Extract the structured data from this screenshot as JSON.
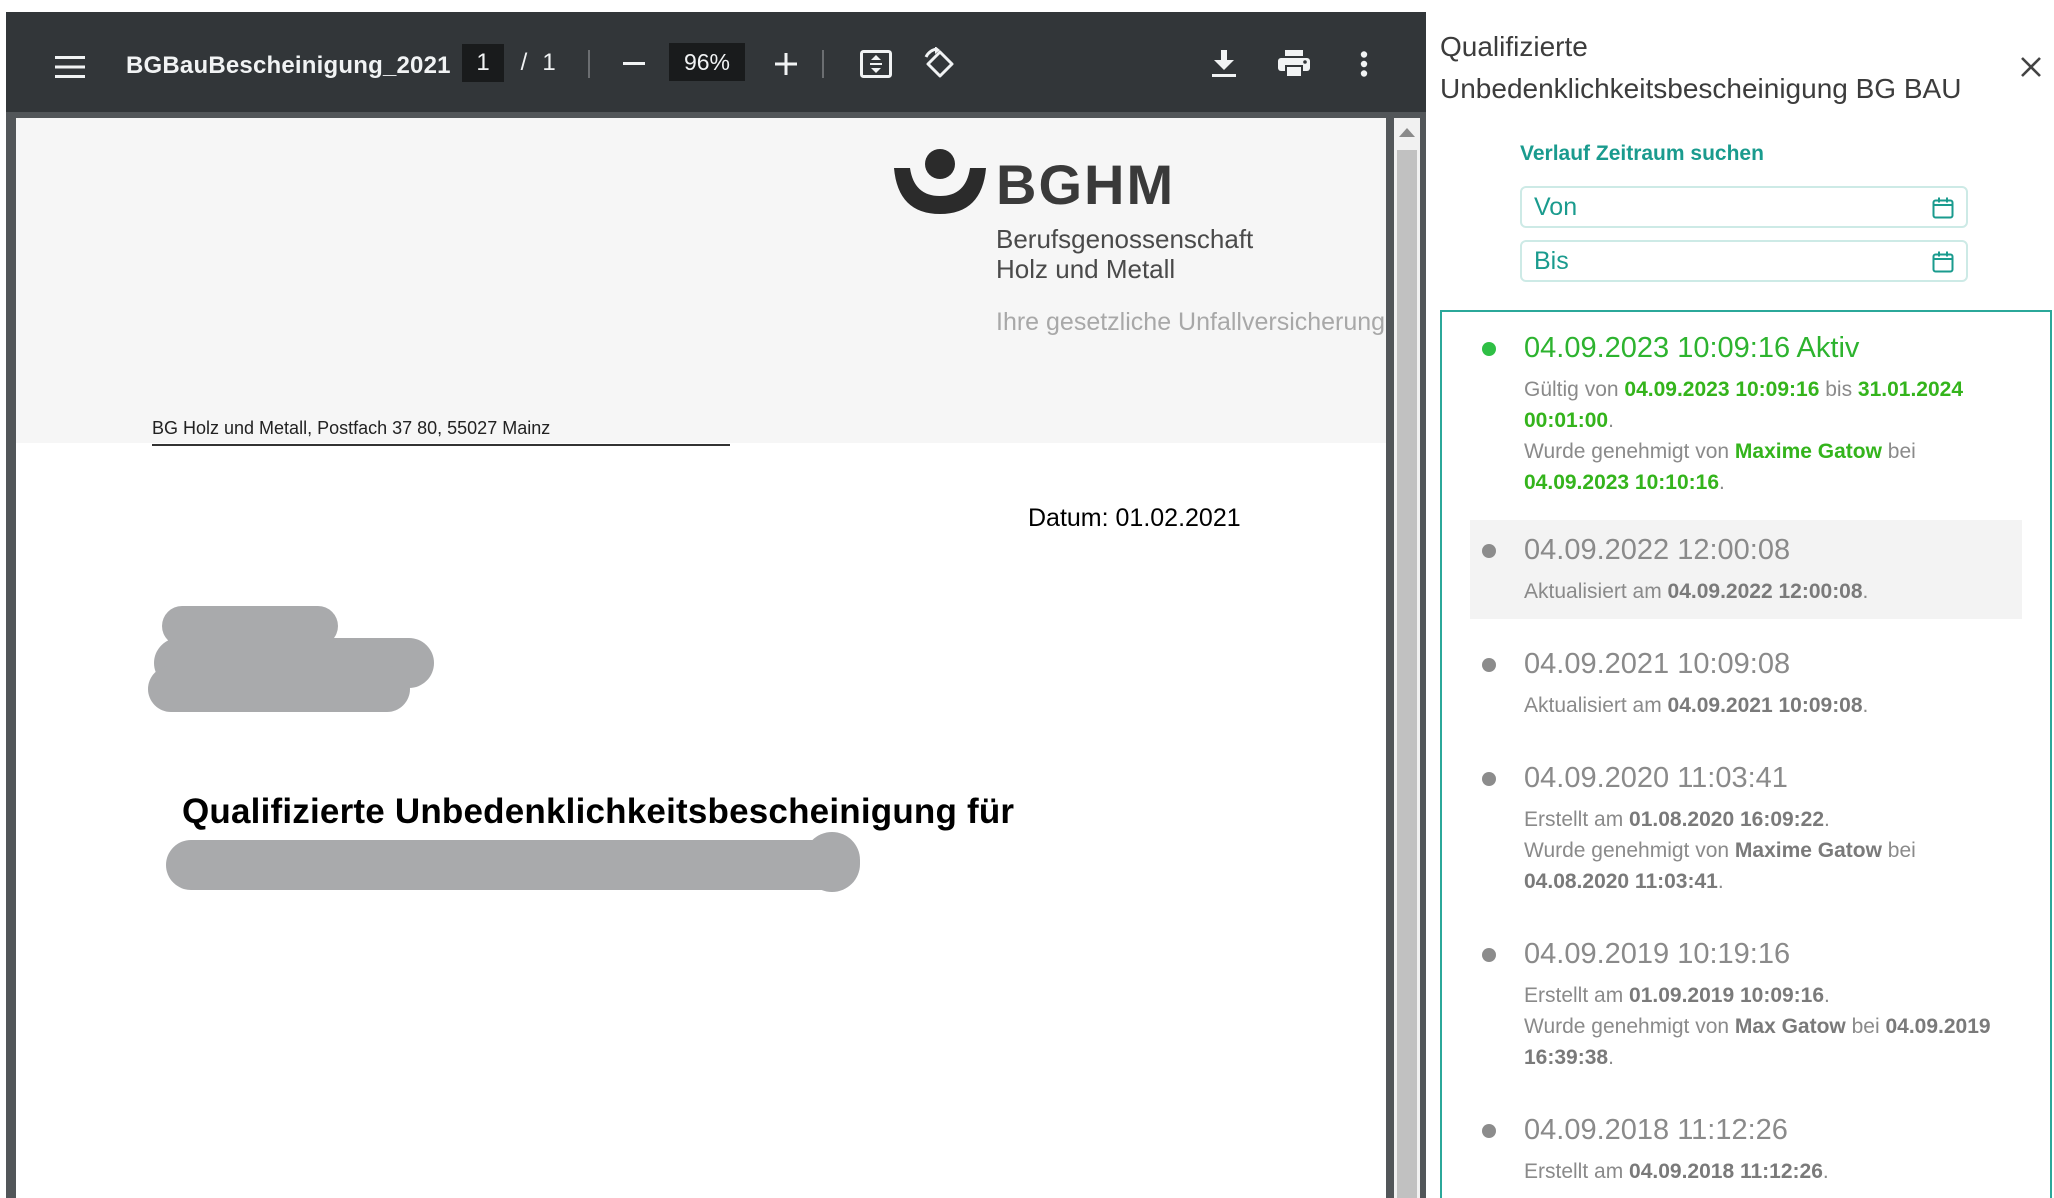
{
  "viewer": {
    "title": "BGBauBescheinigung_2021",
    "page_current": "1",
    "page_separator": "/",
    "page_total": "1",
    "zoom": "96%"
  },
  "document": {
    "logo_text": "BGHM",
    "logo_line1": "Berufsgenossenschaft",
    "logo_line2": "Holz und Metall",
    "logo_tagline": "Ihre gesetzliche Unfallversicherung",
    "sender": "BG Holz und Metall, Postfach 37 80, 55027 Mainz",
    "datum": "Datum: 01.02.2021",
    "heading": "Qualifizierte Unbedenklichkeitsbescheinigung für"
  },
  "panel": {
    "title": "Qualifizierte Unbedenklichkeitsbescheinigung BG BAU",
    "search_label": "Verlauf Zeitraum suchen",
    "von": "Von",
    "bis": "Bis",
    "colors": {
      "accent": "#1a9b8e",
      "active": "#2db32f",
      "muted": "#8a8a8a"
    }
  },
  "history": [
    {
      "date": "04.09.2023 10:09:16 Aktiv",
      "active": true,
      "l1_a": "Gültig von ",
      "l1_b": "04.09.2023 10:09:16",
      "l1_c": " bis ",
      "l1_d": "31.01.2024",
      "l2_a": "00:01:00",
      "l2_b": ".",
      "l3_a": "Wurde genehmigt von ",
      "l3_b": "Maxime Gatow",
      "l3_c": " bei",
      "l4_a": "04.09.2023 10:10:16",
      "l4_b": "."
    },
    {
      "date": "04.09.2022 12:00:08",
      "l1_a": "Aktualisiert am ",
      "l1_b": "04.09.2022 12:00:08",
      "l1_c": "."
    },
    {
      "date": "04.09.2021 10:09:08",
      "l1_a": "Aktualisiert am ",
      "l1_b": "04.09.2021 10:09:08",
      "l1_c": "."
    },
    {
      "date": "04.09.2020 11:03:41",
      "l1_a": "Erstellt am ",
      "l1_b": "01.08.2020 16:09:22",
      "l1_c": ".",
      "l2_a": "Wurde genehmigt von ",
      "l2_b": "Maxime Gatow",
      "l2_c": " bei",
      "l3_a": "04.08.2020 11:03:41",
      "l3_b": "."
    },
    {
      "date": "04.09.2019 10:19:16",
      "l1_a": "Erstellt am ",
      "l1_b": "01.09.2019 10:09:16",
      "l1_c": ".",
      "l2_a": "Wurde genehmigt von ",
      "l2_b": "Max Gatow",
      "l2_c": " bei ",
      "l2_d": "04.09.2019",
      "l3_a": "16:39:38",
      "l3_b": "."
    },
    {
      "date": "04.09.2018 11:12:26",
      "l1_a": "Erstellt am ",
      "l1_b": "04.09.2018 11:12:26",
      "l1_c": "."
    }
  ]
}
